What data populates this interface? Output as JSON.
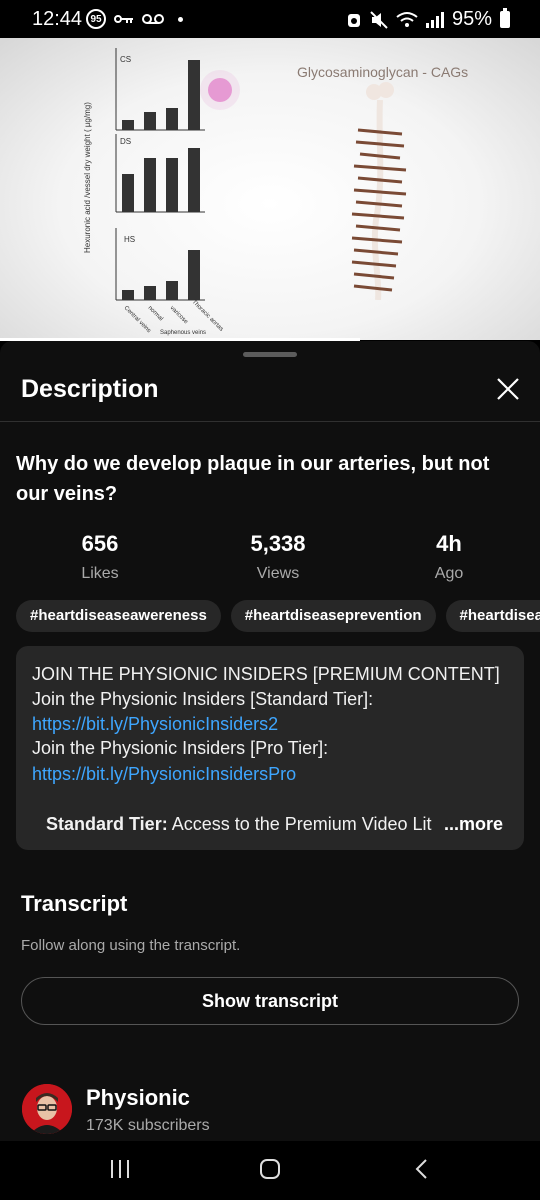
{
  "status_bar": {
    "time": "12:44",
    "badge": "95",
    "battery": "95%"
  },
  "video": {
    "overlay_title": "Glycosaminoglycan - CAGs",
    "chart_labels": {
      "y_axis": "Hexuronic acid /vessel dry weight ( µg/mg)",
      "panel_cs": "CS",
      "panel_ds": "DS",
      "panel_hs": "HS",
      "x_categories": [
        "Central veins",
        "normal",
        "varicose",
        "Thoracic aortas"
      ],
      "x_group": "Saphenous veins"
    }
  },
  "sheet": {
    "title": "Description",
    "video_title": "Why do we develop plaque in our arteries, but not our veins?",
    "stats": [
      {
        "value": "656",
        "label": "Likes"
      },
      {
        "value": "5,338",
        "label": "Views"
      },
      {
        "value": "4h",
        "label": "Ago"
      }
    ],
    "tags": [
      "#heartdiseaseawereness",
      "#heartdiseaseprevention",
      "#heartdiseas"
    ],
    "description": {
      "line1": "JOIN THE PHYSIONIC INSIDERS [PREMIUM CONTENT]",
      "line2": "Join the Physionic Insiders [Standard Tier]:",
      "link1": "https://bit.ly/PhysionicInsiders2",
      "line3": "Join the Physionic Insiders [Pro Tier]:",
      "link2": "https://bit.ly/PhysionicInsidersPro",
      "line4_strong": "Standard Tier:",
      "line4_rest": " Access to the Premium Video Lit",
      "more": "...more"
    },
    "transcript": {
      "title": "Transcript",
      "subtitle": "Follow along using the transcript.",
      "button": "Show transcript"
    },
    "channel": {
      "name": "Physionic",
      "subscribers": "173K subscribers"
    }
  },
  "colors": {
    "link": "#3ea6ff",
    "sheet_bg": "#0f0f0f",
    "chip_bg": "#272727"
  }
}
